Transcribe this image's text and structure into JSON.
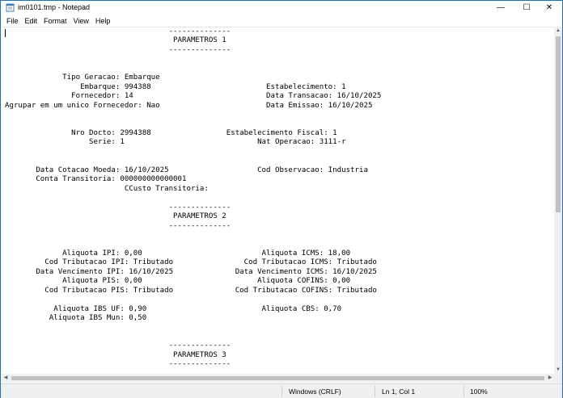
{
  "window": {
    "title": "im0101.tmp - Notepad",
    "controls": {
      "minimize": "—",
      "maximize": "☐",
      "close": "✕"
    }
  },
  "menu": [
    "File",
    "Edit",
    "Format",
    "View",
    "Help"
  ],
  "editor": {
    "content": "                                     --------------\n                                      PARAMETROS 1\n                                     --------------\n\n\n             Tipo Geracao: Embarque\n                 Embarque: 994388                          Estabelecimento: 1\n               Fornecedor: 14                              Data Transacao: 16/10/2025\nAgrupar em um unico Fornecedor: Nao                        Data Emissao: 16/10/2025\n\n\n               Nro Docto: 2994388                 Estabelecimento Fiscal: 1\n                   Serie: 1                              Nat Operacao: 3111-r\n\n\n       Data Cotacao Moeda: 16/10/2025                    Cod Observacao: Industria\n       Conta Transitoria: 000000000000001\n                           CCusto Transitoria:\n\n                                     --------------\n                                      PARAMETROS 2\n                                     --------------\n\n\n             Aliquota IPI: 0,00                           Aliquota ICMS: 18,00\n         Cod Tributacao IPI: Tributado                Cod Tributacao ICMS: Tributado\n       Data Vencimento IPI: 16/10/2025              Data Vencimento ICMS: 16/10/2025\n             Aliquota PIS: 0,00                          Aliquota COFINS: 0,00\n         Cod Tributacao PIS: Tributado              Cod Tributacao COFINS: Tributado\n\n           Aliquota IBS UF: 0,90                          Aliquota CBS: 0,70\n          Aliquota IBS Mun: 0,50\n\n\n                                     --------------\n                                      PARAMETROS 3\n                                     --------------"
  },
  "statusbar": {
    "line_ending": "Windows (CRLF)",
    "position": "Ln 1, Col 1",
    "zoom": "100%"
  },
  "colors": {
    "window_border": "#1a73c7",
    "scrollbar_thumb": "#c1c1c1",
    "statusbar_bg": "#f0f0f0"
  },
  "icons": {
    "app": "notepad-icon",
    "scroll_up": "▲",
    "scroll_down": "▼",
    "scroll_left": "◀",
    "scroll_right": "▶"
  }
}
